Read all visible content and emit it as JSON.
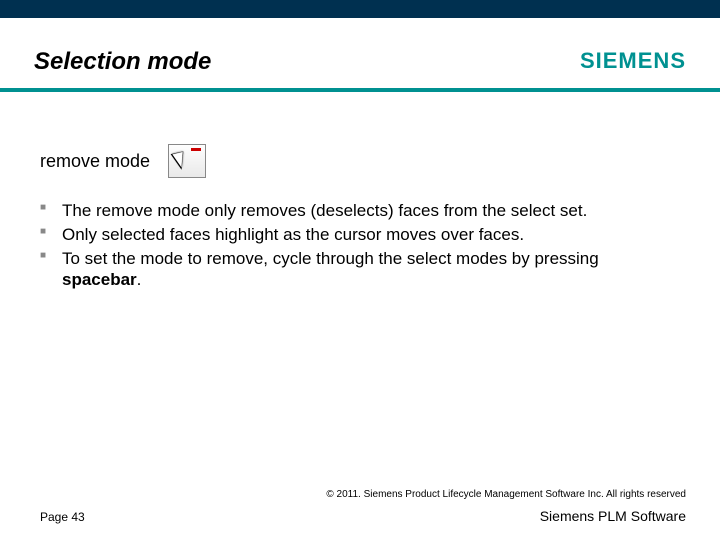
{
  "brand": {
    "logo_text": "SIEMENS",
    "plm_text": "Siemens PLM Software"
  },
  "slide": {
    "title": "Selection mode",
    "subhead": "remove mode",
    "icon": "cursor-remove-icon"
  },
  "bullets": [
    "The remove mode only removes (deselects) faces from the select set.",
    "Only selected faces highlight as the cursor moves over faces.",
    "To set the mode to remove, cycle through the select modes by pressing "
  ],
  "bullet3_strong": "spacebar",
  "bullet3_tail": ".",
  "footer": {
    "copyright": "© 2011. Siemens Product Lifecycle Management Software Inc. All rights reserved",
    "page": "Page 43"
  }
}
